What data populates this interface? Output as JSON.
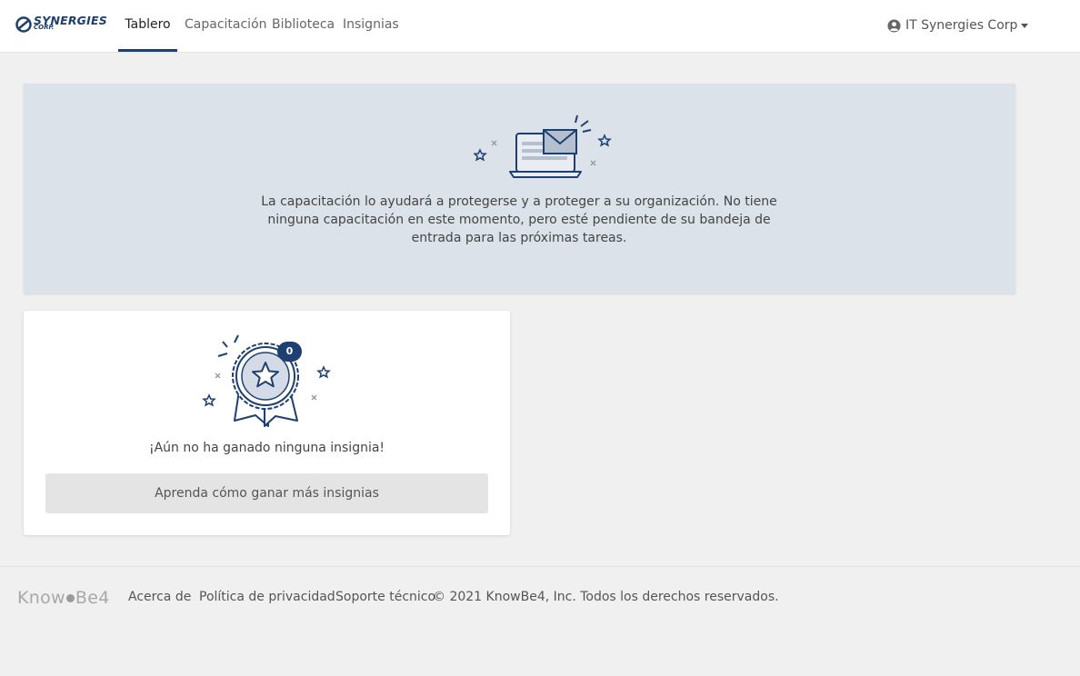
{
  "header": {
    "logo_text": "SYNERGIES",
    "logo_sub": "CORP.",
    "tabs": [
      {
        "label": "Tablero",
        "active": true
      },
      {
        "label": "Capacitación",
        "active": false
      },
      {
        "label": "Biblioteca",
        "active": false
      },
      {
        "label": "Insignias",
        "active": false
      }
    ],
    "user_label": "IT Synergies Corp"
  },
  "training": {
    "message": "La capacitación lo ayudará a protegerse y a proteger a su organización. No tiene ninguna capacitación en este momento, pero esté pendiente de su bandeja de entrada para las próximas tareas."
  },
  "badges": {
    "count": "0",
    "message": "¡Aún no ha ganado ninguna insignia!",
    "button_label": "Aprenda cómo ganar más insignias"
  },
  "footer": {
    "logo_text_left": "Know",
    "logo_text_right": "Be4",
    "links": [
      "Acerca de",
      "Política de privacidad",
      "Soporte técnico"
    ],
    "copyright": "© 2021 KnowBe4, Inc. Todos los derechos reservados."
  },
  "colors": {
    "accent": "#1d3f72",
    "banner_bg": "#dce2ea",
    "page_bg": "#f0f0f0"
  },
  "icons": [
    "synergies-logo-icon",
    "user-circle-icon",
    "caret-down-icon",
    "laptop-envelope-icon",
    "badge-ribbon-icon"
  ]
}
